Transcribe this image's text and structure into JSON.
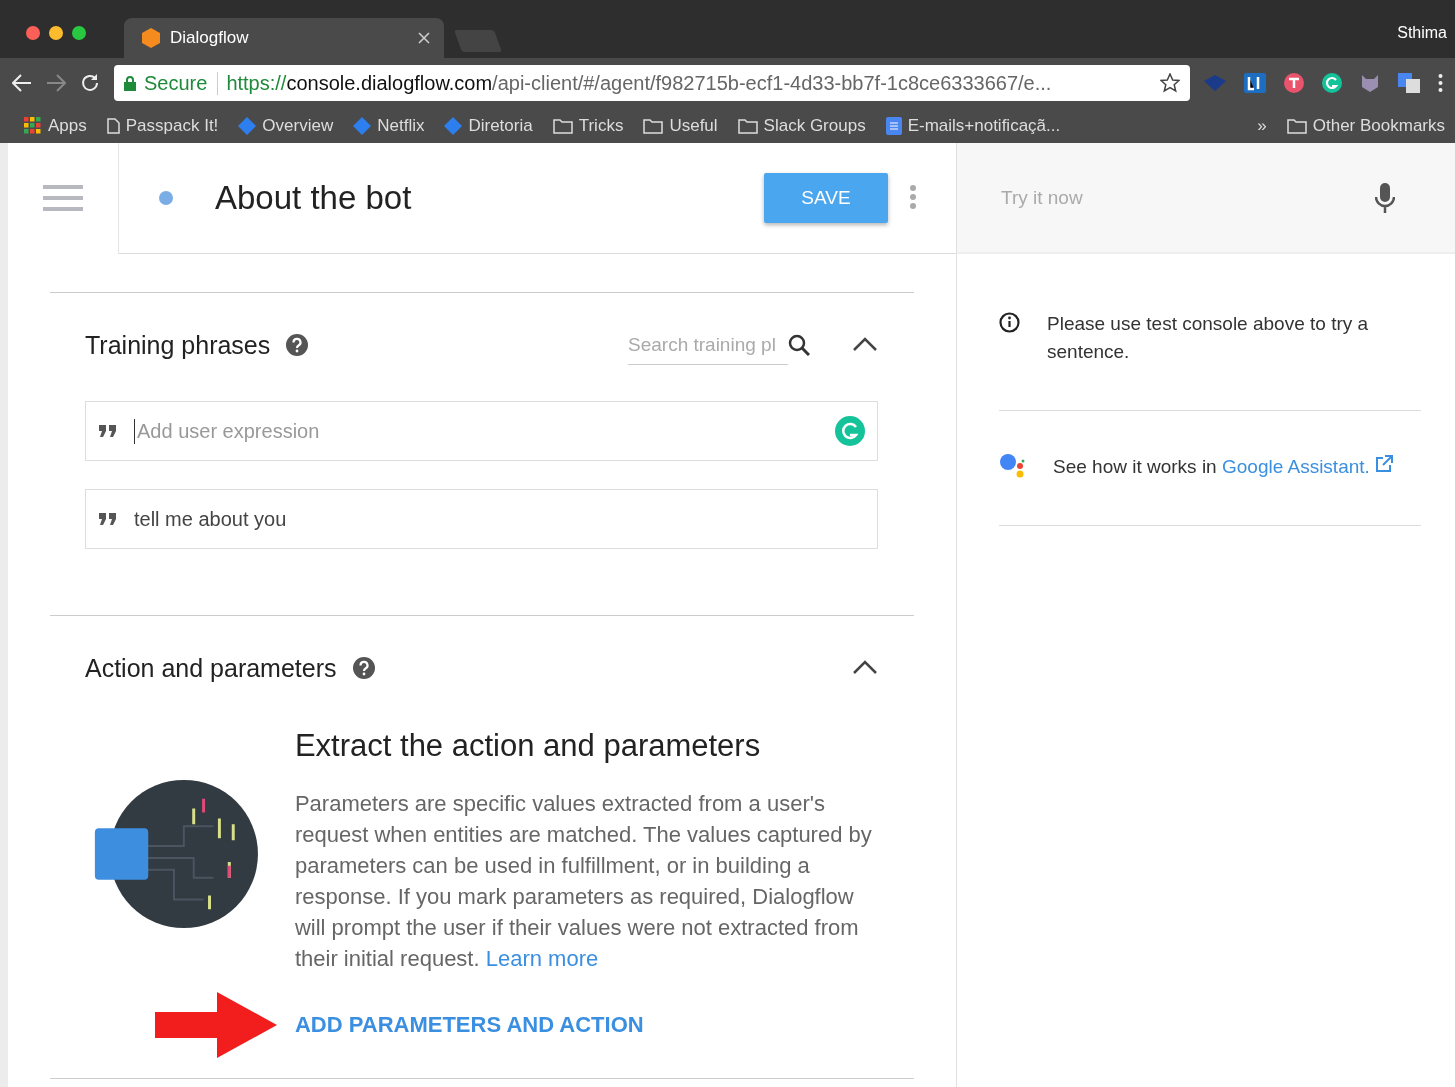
{
  "browser": {
    "tab": {
      "title": "Dialogflow",
      "selected": true
    },
    "profile": "Sthima",
    "address": {
      "secure_label": "Secure",
      "scheme": "https://",
      "host": "console.dialogflow.com",
      "path": "/api-client/#/agent/f982715b-ecf1-4d33-bb7f-1c8ce6333667/e..."
    },
    "bookmarks": [
      {
        "kind": "apps",
        "label": "Apps"
      },
      {
        "kind": "page",
        "label": "Passpack It!"
      },
      {
        "kind": "diamond",
        "label": "Overview"
      },
      {
        "kind": "diamond",
        "label": "Netflix"
      },
      {
        "kind": "diamond",
        "label": "Diretoria"
      },
      {
        "kind": "folder",
        "label": "Tricks"
      },
      {
        "kind": "folder",
        "label": "Useful"
      },
      {
        "kind": "folder",
        "label": "Slack Groups"
      },
      {
        "kind": "doc",
        "label": "E-mails+notificaçã..."
      }
    ],
    "more": "»",
    "other_bookmarks": "Other Bookmarks"
  },
  "header": {
    "title": "About the bot",
    "save": "SAVE"
  },
  "training": {
    "title": "Training phrases",
    "expanded": true,
    "search": {
      "placeholder": "Search training pl"
    },
    "input": {
      "placeholder": "Add user expression"
    },
    "phrases": [
      "tell me about you"
    ]
  },
  "action": {
    "title": "Action and parameters",
    "expanded": true,
    "heading": "Extract the action and parameters",
    "body": "Parameters are specific values extracted from a user's request when entities are matched. The values captured by parameters can be used in fulfillment, or in building a response. If you mark parameters as required, Dialogflow will prompt the user if their values were not extracted from their initial request.",
    "link": "Learn more",
    "button": "ADD PARAMETERS AND ACTION"
  },
  "console": {
    "placeholder": "Try it now",
    "info": "Please use test console above to try a sentence.",
    "assistant_text": "See how it works in",
    "assistant_link": "Google Assistant."
  }
}
